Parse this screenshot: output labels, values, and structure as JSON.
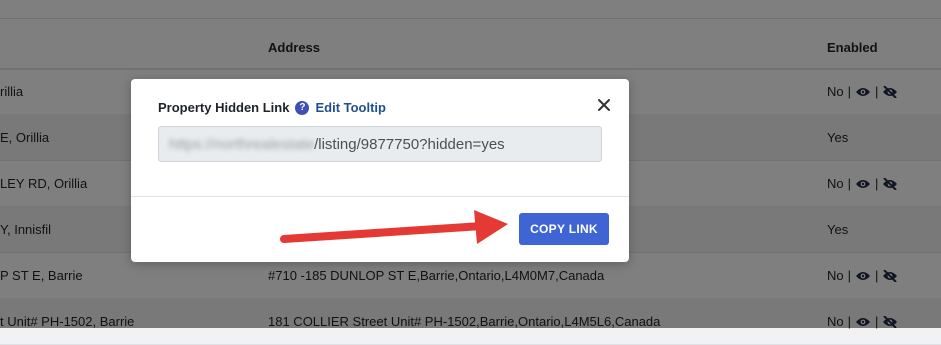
{
  "table": {
    "headers": {
      "address": "Address",
      "enabled": "Enabled"
    },
    "rows": [
      {
        "city": "rillia",
        "address": "",
        "enabled": "No",
        "icons": true
      },
      {
        "city": "E, Orillia",
        "address": "",
        "enabled": "Yes",
        "icons": false
      },
      {
        "city": "LEY RD, Orillia",
        "address": "",
        "enabled": "No",
        "icons": true
      },
      {
        "city": "Y, Innisfil",
        "address": "",
        "enabled": "Yes",
        "icons": false
      },
      {
        "city": "P ST E, Barrie",
        "address": "#710 -185 DUNLOP ST E,Barrie,Ontario,L4M0M7,Canada",
        "enabled": "No",
        "icons": true
      },
      {
        "city": "t Unit# PH-1502, Barrie",
        "address": "181 COLLIER Street Unit# PH-1502,Barrie,Ontario,L4M5L6,Canada",
        "enabled": "No",
        "icons": true
      }
    ],
    "separator": "|"
  },
  "modal": {
    "title": "Property Hidden Link",
    "help_icon": "?",
    "edit_tooltip": "Edit Tooltip",
    "close_icon": "close-icon",
    "link_blurred": "https://northrealestate",
    "link_visible": "/listing/9877750?hidden=yes",
    "copy_button": "COPY LINK"
  },
  "colors": {
    "primary_button": "#3f64d3",
    "link": "#1f4f8f",
    "arrow": "#e53935",
    "overlay": "rgba(0,0,0,0.5)"
  }
}
